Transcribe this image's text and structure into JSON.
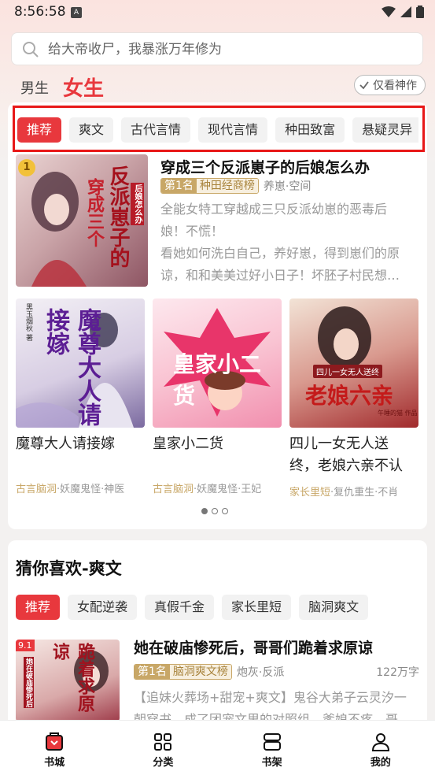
{
  "status_bar": {
    "time": "8:56:58",
    "notification_icon": "A"
  },
  "search": {
    "placeholder": "给大帝收尸，我暴涨万年修为"
  },
  "gender_tabs": {
    "male": "男生",
    "female": "女生"
  },
  "filter_button": {
    "label": "仅看神作"
  },
  "categories": [
    "推荐",
    "爽文",
    "古代言情",
    "现代言情",
    "种田致富",
    "悬疑灵异"
  ],
  "featured": {
    "rank_corner": "1",
    "title": "穿成三个反派崽子的后娘怎么办",
    "rank_label": "第1名",
    "rank_list": "种田经商榜",
    "tags": "养崽·空间",
    "desc_lines": [
      "全能女特工穿越成三只反派幼崽的恶毒后",
      "娘！不慌！",
      "看她如何洗白自己，养好崽，得到崽们的原",
      "谅，和和美美过好小日子！坏胚子村民想…"
    ],
    "cover_text": [
      "反派崽子的",
      "穿成三个",
      "后娘怎么办"
    ]
  },
  "grid_books": [
    {
      "title_lines": [
        "魔尊大人请接嫁"
      ],
      "tag_gold": "古言脑洞",
      "tags_rest": "·妖魔鬼怪·神医",
      "cover_text": "魔尊大人请接嫁",
      "cover_author": "黑玉烟秋 著"
    },
    {
      "title_lines": [
        "皇家小二货"
      ],
      "tag_gold": "古言脑洞",
      "tags_rest": "·妖魔鬼怪·王妃",
      "cover_text": "皇家小二货"
    },
    {
      "title_lines": [
        "四儿一女无人送",
        "终，老娘六亲不认"
      ],
      "tag_gold": "家长里短",
      "tags_rest": "·复仇重生·不肖",
      "cover_text": "老娘六亲",
      "cover_sub": "四儿一女无人送终",
      "cover_author": "午睡的猫 作品"
    }
  ],
  "guess": {
    "title": "猜你喜欢-爽文",
    "chips": [
      "推荐",
      "女配逆袭",
      "真假千金",
      "家长里短",
      "脑洞爽文"
    ],
    "book": {
      "score": "9.1",
      "title": "她在破庙惨死后，哥哥们跪着求原谅",
      "rank_label": "第1名",
      "rank_list": "脑洞爽文榜",
      "tags": "炮灰·反派",
      "words": "122万字",
      "desc_lines": [
        "【追妹火葬场+甜宠+爽文】鬼谷大弟子云灵汐一",
        "朝穿书，成了团宠文里的对照组，爹娘不疼，哥"
      ],
      "cover_text": "跪着求原谅",
      "cover_sub": "她在破庙惨死后"
    }
  },
  "bottom_nav": [
    {
      "label": "书城",
      "icon": "bookstore-icon"
    },
    {
      "label": "分类",
      "icon": "category-icon"
    },
    {
      "label": "书架",
      "icon": "bookshelf-icon"
    },
    {
      "label": "我的",
      "icon": "profile-icon"
    }
  ],
  "colors": {
    "accent": "#e8383d",
    "gold": "#c8a767",
    "annotation_box": "#e81818"
  }
}
